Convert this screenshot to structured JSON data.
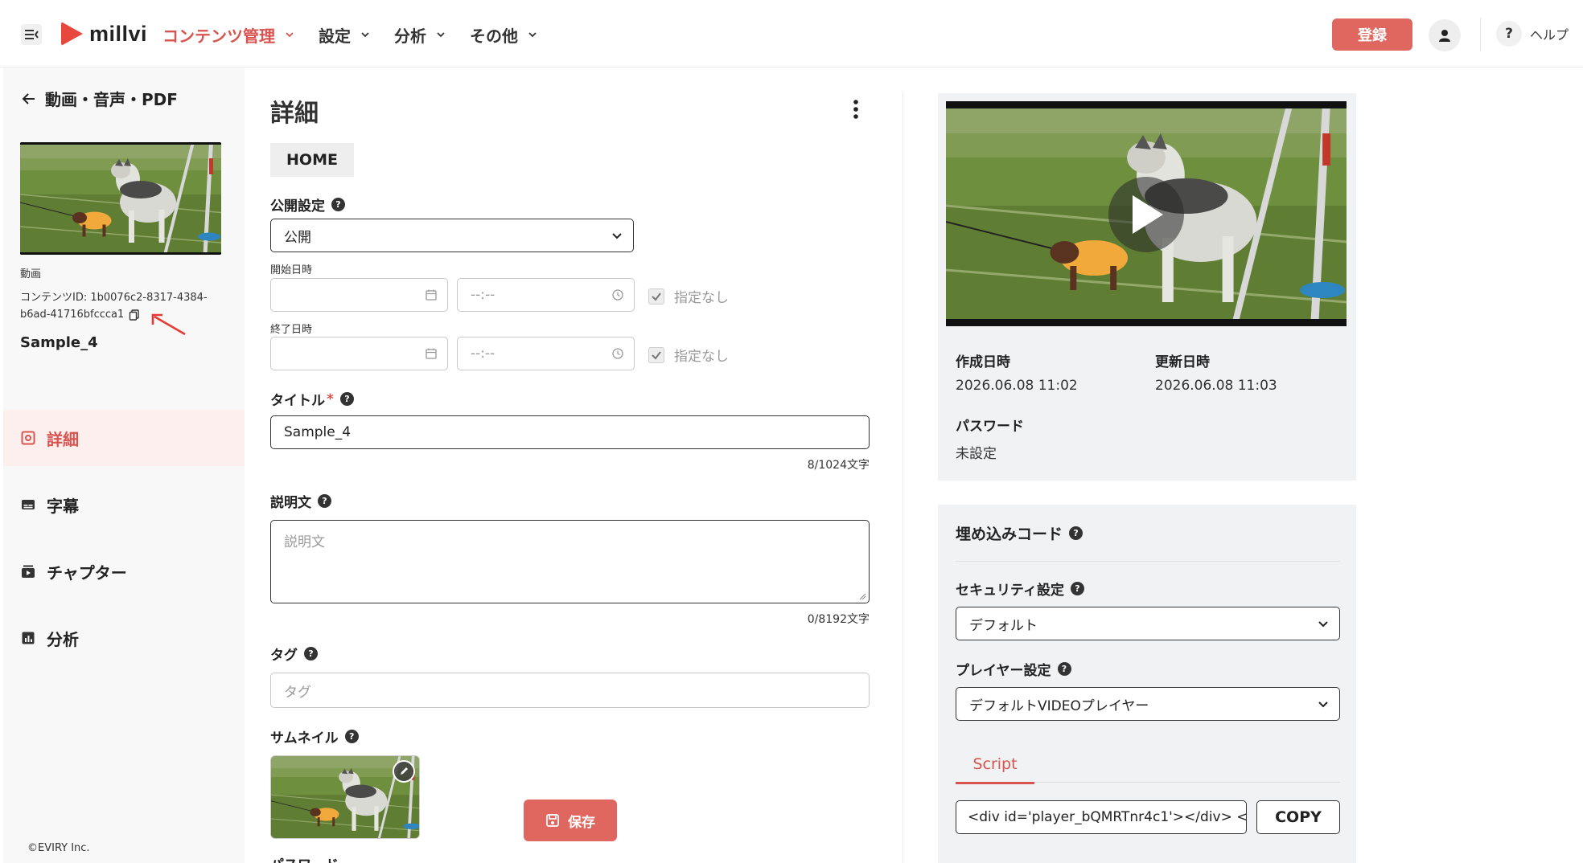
{
  "header": {
    "brand": "millvi",
    "nav": [
      {
        "label": "コンテンツ管理",
        "active": true
      },
      {
        "label": "設定",
        "active": false
      },
      {
        "label": "分析",
        "active": false
      },
      {
        "label": "その他",
        "active": false
      }
    ],
    "register_label": "登録",
    "help_symbol": "?",
    "help_label": "ヘルプ"
  },
  "sidebar": {
    "back_label": "動画・音声・PDF",
    "content_type": "動画",
    "content_id_prefix": "コンテンツID: ",
    "content_id": "1b0076c2-8317-4384-b6ad-41716bfccca1",
    "content_name": "Sample_4",
    "menu": [
      {
        "label": "詳細",
        "icon": "details-icon",
        "active": true
      },
      {
        "label": "字幕",
        "icon": "subtitles-icon",
        "active": false
      },
      {
        "label": "チャプター",
        "icon": "chapter-icon",
        "active": false
      },
      {
        "label": "分析",
        "icon": "analytics-icon",
        "active": false
      }
    ],
    "footer": "©EVIRY Inc."
  },
  "form": {
    "title": "詳細",
    "home_tag": "HOME",
    "visibility_label": "公開設定",
    "visibility_value": "公開",
    "start_label": "開始日時",
    "end_label": "終了日時",
    "time_placeholder": "--:--",
    "unspecified_label": "指定なし",
    "title_label": "タイトル",
    "required_mark": "*",
    "title_value": "Sample_4",
    "title_counter": "8/1024文字",
    "description_label": "説明文",
    "description_placeholder": "説明文",
    "description_counter": "0/8192文字",
    "tag_label": "タグ",
    "tag_placeholder": "タグ",
    "thumbnail_label": "サムネイル",
    "save_label": "保存",
    "password_label_cut": "パスワード"
  },
  "info": {
    "created_label": "作成日時",
    "created_value": "2026.06.08 11:02",
    "updated_label": "更新日時",
    "updated_value": "2026.06.08 11:03",
    "password_label": "パスワード",
    "password_value": "未設定"
  },
  "embed": {
    "title": "埋め込みコード",
    "security_label": "セキュリティ設定",
    "security_value": "デフォルト",
    "player_label": "プレイヤー設定",
    "player_value": "デフォルトVIDEOプレイヤー",
    "tab_script": "Script",
    "code_value": "<div id='player_bQMRTnr4c1'></div> <",
    "copy_label": "COPY"
  },
  "colors": {
    "accent": "#e06760",
    "accent_text": "#d9534f",
    "panel_bg": "#f1f2f4"
  }
}
